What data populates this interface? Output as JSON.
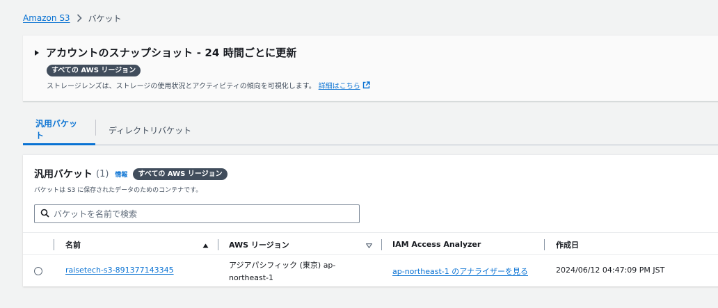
{
  "breadcrumb": {
    "root": "Amazon S3",
    "current": "バケット"
  },
  "snapshot": {
    "title": "アカウントのスナップショット - 24 時間ごとに更新",
    "badge": "すべての AWS リージョン",
    "description": "ストレージレンズは、ストレージの使用状況とアクティビティの傾向を可視化します。",
    "link": "詳細はこちら"
  },
  "tabs": [
    {
      "label": "汎用バケット",
      "active": true
    },
    {
      "label": "ディレクトリバケット",
      "active": false
    }
  ],
  "buckets_panel": {
    "title": "汎用バケット",
    "count": "(1)",
    "info": "情報",
    "badge": "すべての AWS リージョン",
    "description": "バケットは S3 に保存されたデータのためのコンテナです。",
    "search_placeholder": "バケットを名前で検索"
  },
  "table": {
    "columns": [
      "名前",
      "AWS リージョン",
      "IAM Access Analyzer",
      "作成日"
    ],
    "rows": [
      {
        "name": "raisetech-s3-891377143345",
        "region_line1": "アジアパシフィック (東京) ap-",
        "region_line2": "northeast-1",
        "analyzer": "ap-northeast-1 のアナライザーを見る",
        "created": "2024/06/12 04:47:09 PM JST"
      }
    ]
  },
  "colors": {
    "link": "#0972d3",
    "badge_bg": "#414d5c",
    "text": "#16191f"
  }
}
